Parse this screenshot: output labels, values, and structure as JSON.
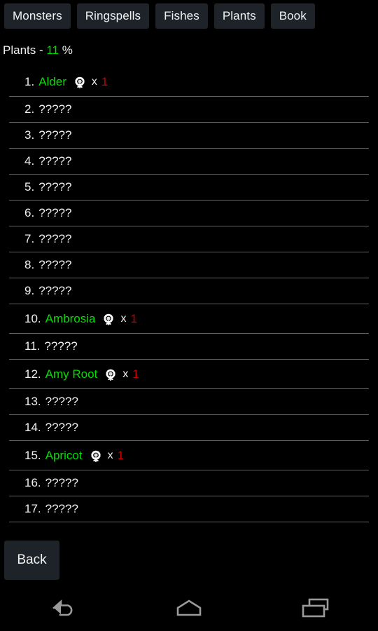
{
  "app": {
    "background_color": "#000000",
    "accent_green": "#00e000",
    "accent_red": "#cc0000",
    "button_bg": "#1d2329",
    "divider_color": "#636363"
  },
  "tabs": [
    {
      "label": "Monsters",
      "name": "tab-monsters"
    },
    {
      "label": "Ringspells",
      "name": "tab-ringspells"
    },
    {
      "label": "Fishes",
      "name": "tab-fishes"
    },
    {
      "label": "Plants",
      "name": "tab-plants"
    },
    {
      "label": "Book",
      "name": "tab-book"
    }
  ],
  "header": {
    "prefix": "Plants - ",
    "percent": "11",
    "suffix": " %"
  },
  "list": {
    "rows": [
      {
        "index": "1.",
        "name": "Alder",
        "icon": "flower-icon",
        "x": "x",
        "qty": "1",
        "known": true
      },
      {
        "index": "2.",
        "name": "?????",
        "known": false
      },
      {
        "index": "3.",
        "name": "?????",
        "known": false
      },
      {
        "index": "4.",
        "name": "?????",
        "known": false
      },
      {
        "index": "5.",
        "name": "?????",
        "known": false
      },
      {
        "index": "6.",
        "name": "?????",
        "known": false
      },
      {
        "index": "7.",
        "name": "?????",
        "known": false
      },
      {
        "index": "8.",
        "name": "?????",
        "known": false
      },
      {
        "index": "9.",
        "name": "?????",
        "known": false
      },
      {
        "index": "10.",
        "name": "Ambrosia",
        "icon": "flower-icon",
        "x": "x",
        "qty": "1",
        "known": true
      },
      {
        "index": "11.",
        "name": "?????",
        "known": false
      },
      {
        "index": "12.",
        "name": "Amy Root",
        "icon": "flower-icon",
        "x": "x",
        "qty": "1",
        "known": true
      },
      {
        "index": "13.",
        "name": "?????",
        "known": false
      },
      {
        "index": "14.",
        "name": "?????",
        "known": false
      },
      {
        "index": "15.",
        "name": "Apricot",
        "icon": "flower-icon",
        "x": "x",
        "qty": "1",
        "known": true
      },
      {
        "index": "16.",
        "name": "?????",
        "known": false
      },
      {
        "index": "17.",
        "name": "?????",
        "known": false
      }
    ]
  },
  "footer": {
    "back_label": "Back"
  },
  "navbar": {
    "back_icon": "back-arrow-icon",
    "home_icon": "home-icon",
    "recents_icon": "recents-icon"
  }
}
